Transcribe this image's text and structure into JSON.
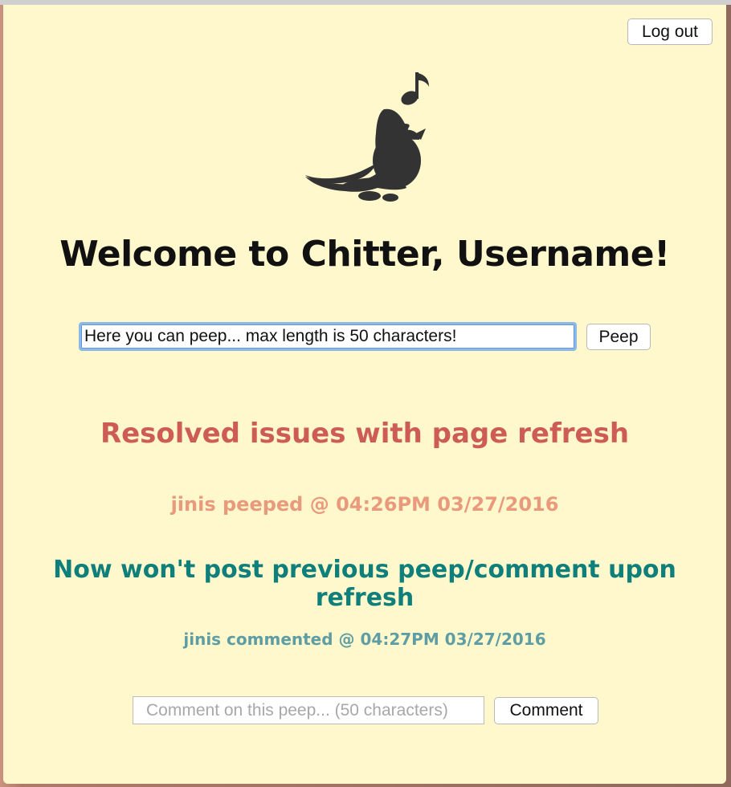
{
  "header": {
    "logout_label": "Log out"
  },
  "logo": {
    "icon": "bird-with-music-note-icon",
    "color": "#333333"
  },
  "welcome": {
    "title": "Welcome to Chitter, Username!"
  },
  "peep_form": {
    "value": "Here you can peep... max length is 50 characters!",
    "submit_label": "Peep"
  },
  "peeps": [
    {
      "text": "Resolved issues with page refresh",
      "meta": "jinis peeped @ 04:26PM 03/27/2016",
      "comments": [
        {
          "text": "Now won't post previous peep/comment upon refresh",
          "meta": "jinis commented @ 04:27PM 03/27/2016"
        }
      ]
    }
  ],
  "comment_form": {
    "placeholder": "Comment on this peep... (50 characters)",
    "submit_label": "Comment"
  },
  "colors": {
    "page_background": "#fff8cc",
    "peep_text": "#cc5c55",
    "peep_meta": "#e99a7d",
    "comment_text": "#0f7f7b",
    "comment_meta": "#5f9da4",
    "focus_ring": "#8cb8ea"
  }
}
